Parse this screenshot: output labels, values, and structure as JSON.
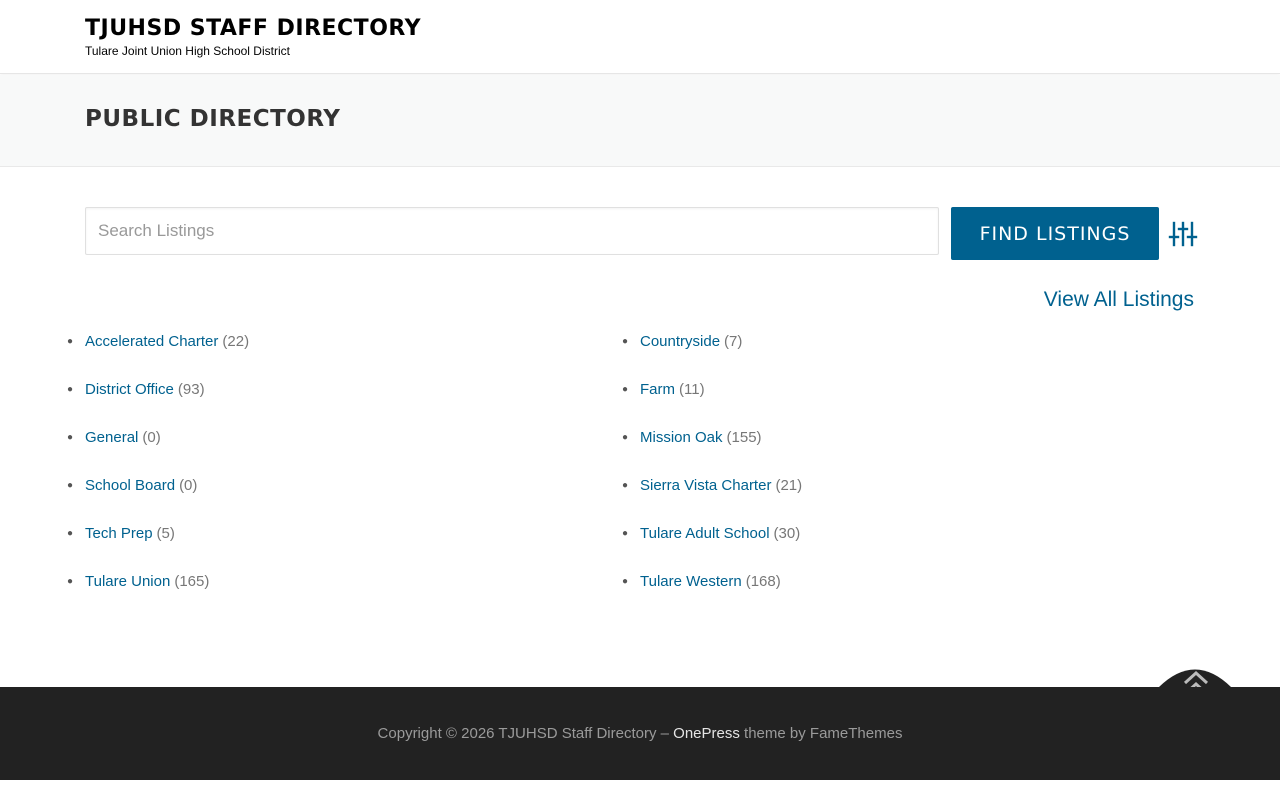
{
  "header": {
    "site_title": "TJUHSD STAFF DIRECTORY",
    "site_description": "Tulare Joint Union High School District"
  },
  "page": {
    "title": "PUBLIC DIRECTORY"
  },
  "search": {
    "placeholder": "Search Listings",
    "value": "",
    "button_label": "FIND LISTINGS",
    "filter_icon": "sliders-icon"
  },
  "view_all_label": "View All Listings",
  "categories_left": [
    {
      "name": "Accelerated Charter",
      "count": "(22)"
    },
    {
      "name": "District Office",
      "count": "(93)"
    },
    {
      "name": "General",
      "count": "(0)"
    },
    {
      "name": "School Board",
      "count": "(0)"
    },
    {
      "name": "Tech Prep",
      "count": "(5)"
    },
    {
      "name": "Tulare Union",
      "count": "(165)"
    }
  ],
  "categories_right": [
    {
      "name": "Countryside",
      "count": "(7)"
    },
    {
      "name": "Farm",
      "count": "(11)"
    },
    {
      "name": "Mission Oak",
      "count": "(155)"
    },
    {
      "name": "Sierra Vista Charter",
      "count": "(21)"
    },
    {
      "name": "Tulare Adult School",
      "count": "(30)"
    },
    {
      "name": "Tulare Western",
      "count": "(168)"
    }
  ],
  "footer": {
    "copyright": "Copyright © 2026 TJUHSD Staff Directory –",
    "theme_name": "OnePress",
    "theme_by": "theme by FameThemes",
    "back_to_top_icon": "double-chevron-up-icon"
  },
  "colors": {
    "accent": "#00618f",
    "footer_bg": "#222222",
    "page_header_bg": "#f8f9f9"
  }
}
